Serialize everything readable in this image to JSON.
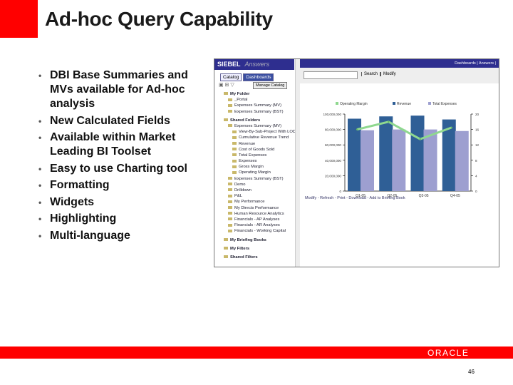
{
  "slide": {
    "title": "Ad-hoc Query Capability",
    "bullets": [
      "DBI Base Summaries and MVs available for Ad-hoc analysis",
      "New Calculated Fields",
      "Available within Market Leading BI Toolset",
      "Easy to use Charting tool",
      "Formatting",
      "Widgets",
      "Highlighting",
      "Multi-language"
    ],
    "brand": "ORACLE",
    "page_number": "46",
    "accent_color": "#ff0000"
  },
  "app": {
    "logo": "SIEBEL",
    "product": "Answers",
    "tabs": [
      "Catalog",
      "Dashboards"
    ],
    "manage_catalog": "Manage Catalog",
    "top_links": "Dashboards | Answers |",
    "search_button": "Search",
    "modify_button": "Modify",
    "tree": [
      {
        "label": "My Folder",
        "level": 0
      },
      {
        "label": "_Portal",
        "level": 1
      },
      {
        "label": "Expenses Summary (MV)",
        "level": 1
      },
      {
        "label": "Expenses Summary (BST)",
        "level": 1
      },
      {
        "label": "Shared Folders",
        "level": 0
      },
      {
        "label": "Expenses Summary (MV)",
        "level": 1
      },
      {
        "label": "View-By-Sub-Project With LOD",
        "level": 2
      },
      {
        "label": "Cumulative Revenue Trend",
        "level": 2
      },
      {
        "label": "Revenue",
        "level": 2
      },
      {
        "label": "Cost of Goods Sold",
        "level": 2
      },
      {
        "label": "Total Expenses",
        "level": 2
      },
      {
        "label": "Expenses",
        "level": 2
      },
      {
        "label": "Gross Margin",
        "level": 2
      },
      {
        "label": "Operating Margin",
        "level": 2
      },
      {
        "label": "Expenses Summary (BST)",
        "level": 1
      },
      {
        "label": "Demo",
        "level": 1
      },
      {
        "label": "Drilldown",
        "level": 1
      },
      {
        "label": "P&L",
        "level": 1
      },
      {
        "label": "My Performance",
        "level": 1
      },
      {
        "label": "My Directs Performance",
        "level": 1
      },
      {
        "label": "Human Resource Analytics",
        "level": 1
      },
      {
        "label": "Financials - AP Analyses",
        "level": 1
      },
      {
        "label": "Financials - AR Analyses",
        "level": 1
      },
      {
        "label": "Financials - Working Capital",
        "level": 1
      },
      {
        "label": "My Briefing Books",
        "level": 0
      },
      {
        "label": "My Filters",
        "level": 0
      },
      {
        "label": "Shared Filters",
        "level": 0
      }
    ],
    "result_links": "Modify - Refresh - Print - Download - Add to Briefing Book"
  },
  "chart_data": {
    "type": "bar",
    "categories": [
      "Q1-05",
      "Q2-05",
      "Q3-05",
      "Q4-05"
    ],
    "series": [
      {
        "name": "Revenue",
        "type": "bar",
        "axis": "left",
        "color": "#2f5f96",
        "values": [
          94000000,
          97000000,
          98000000,
          93000000
        ]
      },
      {
        "name": "Total Expenses",
        "type": "bar",
        "axis": "left",
        "color": "#9d9fd0",
        "values": [
          79000000,
          80000000,
          80000000,
          78000000
        ]
      },
      {
        "name": "Operating Margin",
        "type": "line",
        "axis": "right",
        "color": "#8fd88f",
        "values": [
          16,
          18,
          13.5,
          16.5
        ]
      }
    ],
    "left_ticks": [
      "0",
      "20,000,000",
      "40,000,000",
      "60,000,000",
      "80,000,000",
      "100,000,000"
    ],
    "right_ticks": [
      "0",
      "4",
      "8",
      "12",
      "16",
      "20"
    ],
    "ylim_left": [
      0,
      100000000
    ],
    "ylim_right": [
      0,
      20
    ],
    "legend": "top"
  }
}
